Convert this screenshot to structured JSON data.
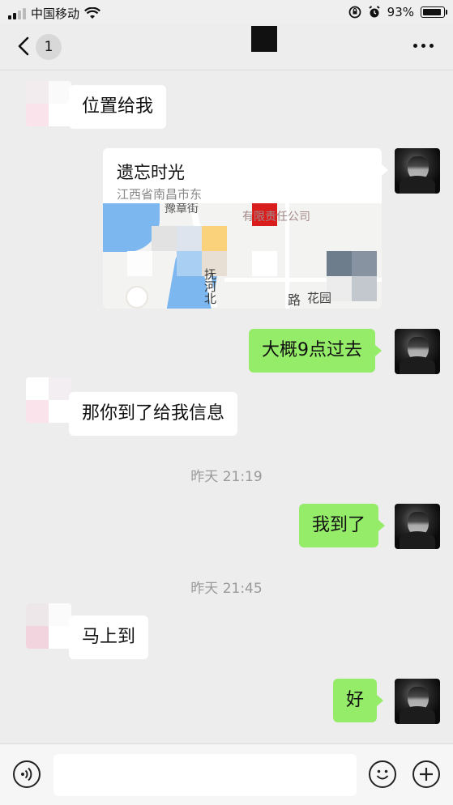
{
  "status_bar": {
    "carrier": "中国移动",
    "battery_percent": "93%",
    "icons": [
      "signal-icon",
      "wifi-icon",
      "rotation-lock-icon",
      "alarm-icon",
      "battery-icon"
    ]
  },
  "nav": {
    "back_badge": "1",
    "icons": [
      "back-chevron-icon",
      "more-dots-icon"
    ]
  },
  "messages": [
    {
      "side": "in",
      "type": "text",
      "text": "位置给我"
    },
    {
      "side": "out",
      "type": "location",
      "name": "遗忘时光",
      "address": "江西省南昌市东",
      "map_labels": {
        "street": "豫章街",
        "company": "有限责任公司",
        "road_vertical": "抚河北",
        "road": "路",
        "flower": "花园"
      }
    },
    {
      "side": "out",
      "type": "text",
      "text": "大概9点过去"
    },
    {
      "side": "in",
      "type": "text",
      "text": "那你到了给我信息"
    },
    {
      "type": "time",
      "text": "昨天 21:19"
    },
    {
      "side": "out",
      "type": "text",
      "text": "我到了"
    },
    {
      "type": "time",
      "text": "昨天 21:45"
    },
    {
      "side": "in",
      "type": "text",
      "text": "马上到"
    },
    {
      "side": "out",
      "type": "text",
      "text": "好"
    }
  ],
  "input_bar": {
    "icons": [
      "voice-icon",
      "emoji-icon",
      "plus-icon"
    ],
    "placeholder": ""
  },
  "colors": {
    "background": "#ededed",
    "outgoing_bubble": "#95ec69",
    "incoming_bubble": "#ffffff",
    "timestamp": "#9a9a9a"
  }
}
